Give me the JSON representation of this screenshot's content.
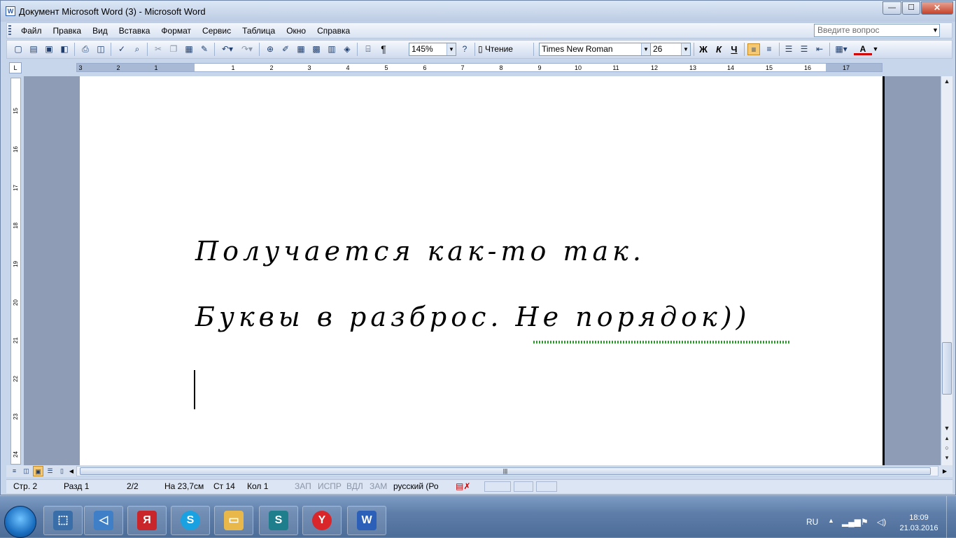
{
  "window": {
    "title": "Документ Microsoft Word (3) - Microsoft Word",
    "minimize_glyph": "—",
    "maximize_glyph": "☐",
    "close_glyph": "✕"
  },
  "menu": {
    "items": [
      "Файл",
      "Правка",
      "Вид",
      "Вставка",
      "Формат",
      "Сервис",
      "Таблица",
      "Окно",
      "Справка"
    ],
    "question_placeholder": "Введите вопрос"
  },
  "toolbar": {
    "zoom": "145%",
    "reading_label": "Чтение",
    "font_name": "Times New Roman",
    "font_size": "26",
    "bold_label": "Ж",
    "italic_label": "К",
    "underline_label": "Ч",
    "pilcrow": "¶",
    "font_color": "A"
  },
  "ruler": {
    "corner": "L",
    "left_numbers": [
      "3",
      "2",
      "1"
    ],
    "right_numbers": [
      "1",
      "2",
      "3",
      "4",
      "5",
      "6",
      "7",
      "8",
      "9",
      "10",
      "11",
      "12",
      "13",
      "14",
      "15",
      "16",
      "17"
    ],
    "vertical_numbers": [
      "15",
      "16",
      "17",
      "18",
      "19",
      "20",
      "21",
      "22",
      "23",
      "24"
    ]
  },
  "document": {
    "line1": "Получается как-то так.",
    "line2": "Буквы в разброс. Не порядок))"
  },
  "status": {
    "page": "Стр. 2",
    "section": "Разд 1",
    "pages": "2/2",
    "at": "На 23,7см",
    "line": "Ст 14",
    "col": "Кол 1",
    "rec": "ЗАП",
    "trk": "ИСПР",
    "ext": "ВДЛ",
    "ovr": "ЗАМ",
    "language": "русский (Ро"
  },
  "taskbar": {
    "lang": "RU",
    "time": "18:09",
    "date": "21.03.2016",
    "apps": [
      {
        "icon": "yandex-browser-icon",
        "glyph": "Я",
        "color": "#c9262c"
      },
      {
        "icon": "skype-icon",
        "glyph": "S",
        "color": "#1aa1e1"
      },
      {
        "icon": "folder-icon",
        "glyph": "▭",
        "color": "#e8b84a"
      },
      {
        "icon": "s-app-icon",
        "glyph": "S",
        "color": "#1f7e8c"
      },
      {
        "icon": "yandex-icon",
        "glyph": "Y",
        "color": "#d8262a"
      },
      {
        "icon": "word-icon",
        "glyph": "W",
        "color": "#2b5fb8"
      }
    ]
  },
  "colors": {
    "spell_underline": "#2e9b2e",
    "active_button": "#f5c873"
  }
}
